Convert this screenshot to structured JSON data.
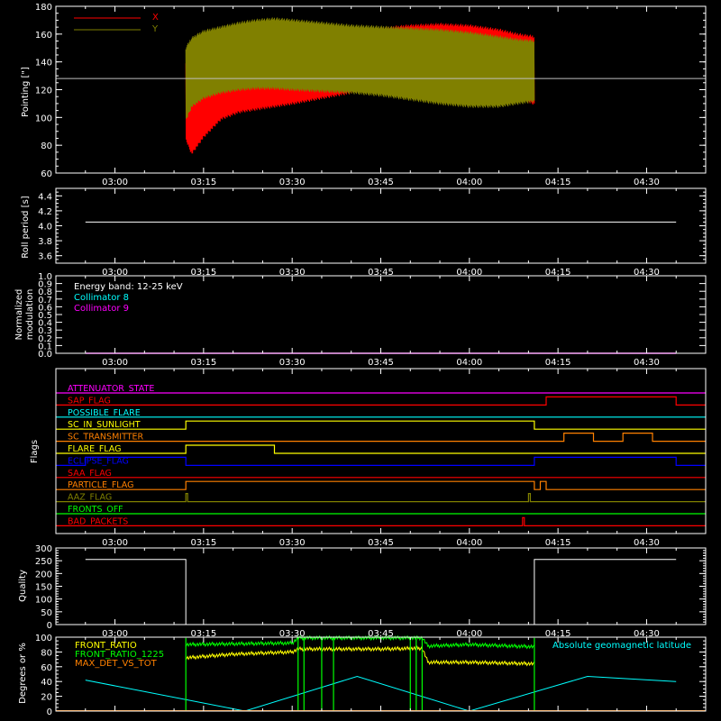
{
  "chart_data": [
    {
      "type": "line",
      "panel": "pointing",
      "ylabel": "Pointing [\"]",
      "ylim": [
        60,
        180
      ],
      "yticks": [
        60,
        80,
        100,
        120,
        140,
        160,
        180
      ],
      "xlim_minutes": [
        170,
        280
      ],
      "xticks": [
        "03:00",
        "03:15",
        "03:30",
        "03:45",
        "04:00",
        "04:15",
        "04:30"
      ],
      "reference_line": 128,
      "series": [
        {
          "name": "X",
          "color": "#ff0000",
          "x": [
            "03:12",
            "03:13",
            "03:15",
            "03:18",
            "03:21",
            "03:24",
            "03:27",
            "03:30",
            "03:35",
            "03:40",
            "03:45",
            "03:50",
            "03:55",
            "04:00",
            "04:05",
            "04:08",
            "04:11"
          ],
          "upper": [
            140,
            152,
            158,
            162,
            165,
            166,
            166,
            164,
            163,
            162,
            164,
            166,
            167,
            166,
            163,
            160,
            158
          ],
          "lower": [
            84,
            74,
            86,
            99,
            104,
            106,
            108,
            110,
            114,
            118,
            120,
            122,
            123,
            121,
            118,
            114,
            110
          ]
        },
        {
          "name": "Y",
          "color": "#808000",
          "x": [
            "03:12",
            "03:13",
            "03:15",
            "03:18",
            "03:21",
            "03:24",
            "03:27",
            "03:30",
            "03:35",
            "03:40",
            "03:45",
            "03:50",
            "03:55",
            "04:00",
            "04:05",
            "04:08",
            "04:11"
          ],
          "upper": [
            150,
            157,
            162,
            165,
            168,
            170,
            171,
            170,
            168,
            166,
            165,
            164,
            163,
            161,
            158,
            156,
            155
          ],
          "lower": [
            98,
            108,
            114,
            118,
            120,
            121,
            121,
            120,
            119,
            118,
            116,
            113,
            110,
            108,
            108,
            110,
            112
          ]
        }
      ]
    },
    {
      "type": "line",
      "panel": "roll_period",
      "ylabel": "Roll period [s]",
      "ylim": [
        3.5,
        4.5
      ],
      "yticks": [
        "3.6",
        "3.8",
        "4.0",
        "4.2",
        "4.4"
      ],
      "xticks": [
        "03:00",
        "03:15",
        "03:30",
        "03:45",
        "04:00",
        "04:15",
        "04:30"
      ],
      "series": [
        {
          "color": "#ffffff",
          "x": [
            "02:55",
            "04:35"
          ],
          "y": [
            4.05,
            4.05
          ]
        }
      ]
    },
    {
      "type": "line",
      "panel": "modulation",
      "ylabel_line1": "Normalized",
      "ylabel_line2": "modulation",
      "ylim": [
        0.0,
        1.0
      ],
      "yticks": [
        "0.0",
        "0.1",
        "0.2",
        "0.3",
        "0.4",
        "0.5",
        "0.6",
        "0.7",
        "0.8",
        "0.9",
        "1.0"
      ],
      "xticks": [
        "03:00",
        "03:15",
        "03:30",
        "03:45",
        "04:00",
        "04:15",
        "04:30"
      ],
      "legend": [
        {
          "text": "Energy band: 12-25 keV",
          "color": "#ffffff"
        },
        {
          "text": "Collimator 8",
          "color": "#00ffff"
        },
        {
          "text": "Collimator 9",
          "color": "#ff00ff"
        }
      ],
      "series": [
        {
          "name": "Collimator 9",
          "color": "#ff00ff",
          "x": [
            "02:55",
            "04:35"
          ],
          "y": [
            0.0,
            0.0
          ]
        }
      ]
    },
    {
      "type": "line",
      "panel": "flags",
      "ylabel": "Flags",
      "xticks": [
        "03:00",
        "03:15",
        "03:30",
        "03:45",
        "04:00",
        "04:15",
        "04:30"
      ],
      "flags": [
        {
          "name": "ATTENUATOR_STATE",
          "color": "#ff00ff",
          "high": []
        },
        {
          "name": "SAP_FLAG",
          "color": "#ff0000",
          "high": [
            [
              "04:13",
              "04:35"
            ]
          ]
        },
        {
          "name": "POSSIBLE_FLARE",
          "color": "#00ffff",
          "high": []
        },
        {
          "name": "SC_IN_SUNLIGHT",
          "color": "#ffff00",
          "high": [
            [
              "03:12",
              "04:11"
            ]
          ]
        },
        {
          "name": "SC_TRANSMITTER",
          "color": "#ff8000",
          "high": [
            [
              "04:16",
              "04:21"
            ],
            [
              "04:26",
              "04:31"
            ]
          ]
        },
        {
          "name": "FLARE_FLAG",
          "color": "#ffff00",
          "high": [
            [
              "03:12",
              "03:27"
            ]
          ]
        },
        {
          "name": "ECLIPSE_FLAG",
          "color": "#0000ff",
          "high": [
            [
              "02:55",
              "03:12"
            ],
            [
              "04:11",
              "04:35"
            ]
          ]
        },
        {
          "name": "SAA_FLAG",
          "color": "#ff0000",
          "high": []
        },
        {
          "name": "PARTICLE_FLAG",
          "color": "#ff8000",
          "high": [
            [
              "03:12",
              "04:11"
            ],
            [
              "04:12",
              "04:13"
            ]
          ]
        },
        {
          "name": "AAZ_FLAG",
          "color": "#808000",
          "high": [
            [
              "03:12",
              "03:12"
            ],
            [
              "04:10",
              "04:10"
            ]
          ]
        },
        {
          "name": "FRONTS_OFF",
          "color": "#00ff00",
          "high": []
        },
        {
          "name": "BAD_PACKETS",
          "color": "#ff0000",
          "high": [
            [
              "04:09",
              "04:09"
            ]
          ]
        }
      ]
    },
    {
      "type": "line",
      "panel": "quality",
      "ylabel": "Quality",
      "ylim": [
        0,
        300
      ],
      "yticks": [
        "0",
        "50",
        "100",
        "150",
        "200",
        "250",
        "300"
      ],
      "xticks": [
        "03:00",
        "03:15",
        "03:30",
        "03:45",
        "04:00",
        "04:15",
        "04:30"
      ],
      "series": [
        {
          "color": "#ffffff",
          "x": [
            "02:55",
            "03:12",
            "03:12",
            "04:11",
            "04:11",
            "04:35"
          ],
          "y": [
            255,
            255,
            0,
            0,
            255,
            255
          ]
        }
      ]
    },
    {
      "type": "line",
      "panel": "ratios",
      "ylabel": "Degrees or %",
      "ylim": [
        0,
        100
      ],
      "yticks": [
        "0",
        "20",
        "40",
        "60",
        "80",
        "100"
      ],
      "legend": [
        {
          "text": "FRONT_RATIO",
          "color": "#ffff00"
        },
        {
          "text": "FRONT_RATIO_1225",
          "color": "#00ff00"
        },
        {
          "text": "MAX_DET_VS_TOT",
          "color": "#ff8000"
        }
      ],
      "right_label": "Absolute geomagnetic latitude",
      "right_label_color": "#00ffff",
      "series": [
        {
          "name": "FRONT_RATIO",
          "color": "#ffff00",
          "x": [
            "03:12",
            "03:20",
            "03:30",
            "03:31",
            "03:45",
            "03:52",
            "03:53",
            "04:00",
            "04:11"
          ],
          "y": [
            72,
            77,
            80,
            84,
            84,
            85,
            66,
            66,
            64
          ]
        },
        {
          "name": "FRONT_RATIO_1225",
          "color": "#00ff00",
          "x": [
            "03:12",
            "03:20",
            "03:30",
            "03:31",
            "03:45",
            "03:52",
            "03:53",
            "04:00",
            "04:11"
          ],
          "y": [
            90,
            91,
            92,
            99,
            99,
            99,
            88,
            90,
            87
          ]
        },
        {
          "name": "Absolute geomagnetic latitude",
          "color": "#00ffff",
          "x": [
            "02:55",
            "03:22",
            "03:41",
            "04:00",
            "04:20",
            "04:35"
          ],
          "y": [
            42,
            0,
            47,
            0,
            47,
            40
          ]
        }
      ]
    }
  ]
}
